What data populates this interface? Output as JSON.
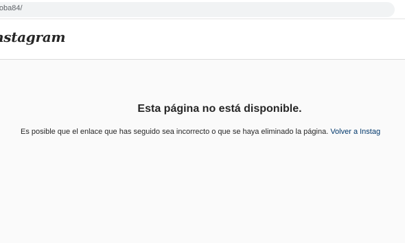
{
  "browser": {
    "url": "iloba84/"
  },
  "header": {
    "logo_text": "nstagram"
  },
  "error": {
    "title": "Esta página no está disponible.",
    "description": "Es posible que el enlace que has seguido sea incorrecto o que se haya eliminado la página.",
    "link_label": "Volver a Instag"
  }
}
